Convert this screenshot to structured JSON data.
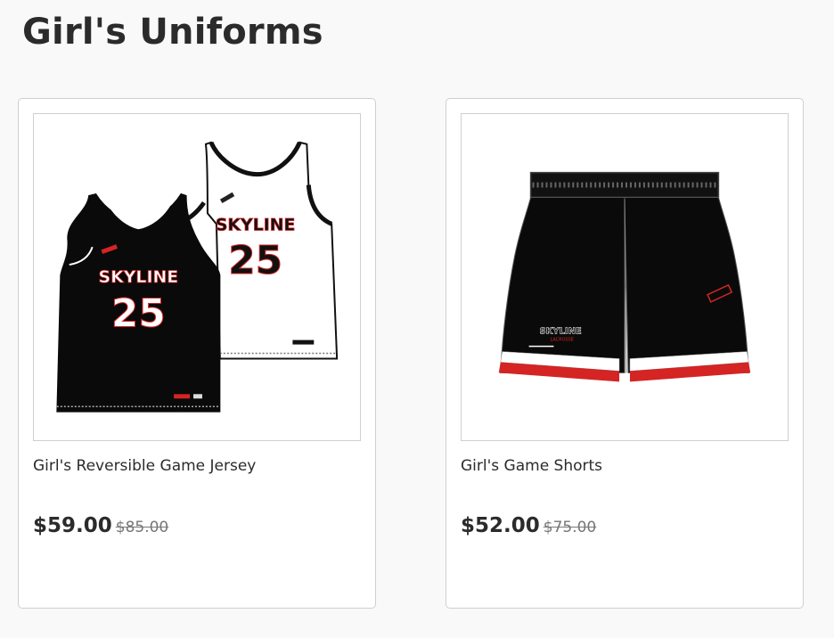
{
  "page": {
    "title": "Girl's Uniforms"
  },
  "products": [
    {
      "name": "Girl's Reversible Game Jersey",
      "price": "$59.00",
      "original_price": "$85.00",
      "image": {
        "front_text": "SKYLINE",
        "front_number": "25",
        "back_text": "SKYLINE",
        "back_number": "25"
      }
    },
    {
      "name": "Girl's Game Shorts",
      "price": "$52.00",
      "original_price": "$75.00",
      "image": {
        "text": "SKYLINE",
        "subtext": "LACROSSE"
      }
    }
  ],
  "colors": {
    "uniform_black": "#0a0a0a",
    "uniform_red": "#d42424",
    "text": "#2b2b2b",
    "muted": "#777777"
  }
}
